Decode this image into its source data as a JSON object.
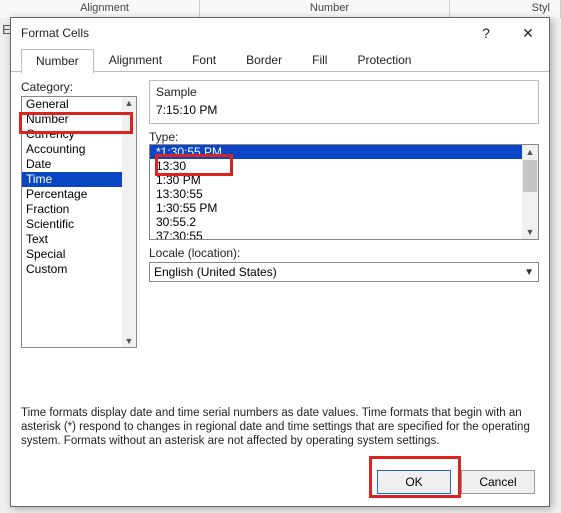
{
  "ribbon": {
    "alignment": "Alignment",
    "number": "Number",
    "styles": "Styl"
  },
  "e_letter": "E",
  "dialog": {
    "title": "Format Cells",
    "help": "?",
    "close": "✕",
    "tabs": [
      "Number",
      "Alignment",
      "Font",
      "Border",
      "Fill",
      "Protection"
    ],
    "active_tab": 0,
    "category_label": "Category:",
    "categories": [
      "General",
      "Number",
      "Currency",
      "Accounting",
      "Date",
      "Time",
      "Percentage",
      "Fraction",
      "Scientific",
      "Text",
      "Special",
      "Custom"
    ],
    "category_selected": 5,
    "sample_label": "Sample",
    "sample_value": "7:15:10 PM",
    "type_label": "Type:",
    "types": [
      "*1:30:55 PM",
      "13:30",
      "1:30 PM",
      "13:30:55",
      "1:30:55 PM",
      "30:55.2",
      "37:30:55"
    ],
    "type_selected": 0,
    "locale_label": "Locale (location):",
    "locale_value": "English (United States)",
    "description": "Time formats display date and time serial numbers as date values.  Time formats that begin with an asterisk (*) respond to changes in regional date and time settings that are specified for the operating system. Formats without an asterisk are not affected by operating system settings.",
    "ok": "OK",
    "cancel": "Cancel"
  }
}
